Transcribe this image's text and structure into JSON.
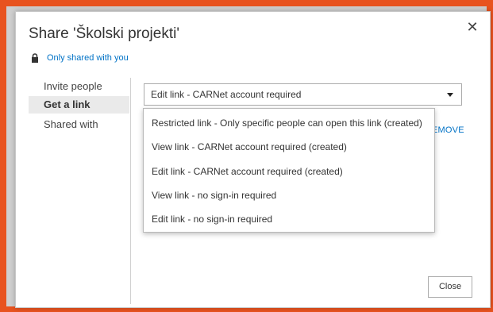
{
  "dialog": {
    "title": "Share 'Školski projekti'",
    "permission_text": "Only shared with you",
    "close_icon": "close-icon"
  },
  "nav": {
    "items": [
      {
        "label": "Invite people"
      },
      {
        "label": "Get a link"
      },
      {
        "label": "Shared with"
      }
    ],
    "active": "Get a link"
  },
  "link_select": {
    "value": "Edit link - CARNet account required",
    "options": [
      "Restricted link - Only specific people can open this link (created)",
      "View link - CARNet account required (created)",
      "Edit link - CARNet account required (created)",
      "View link - no sign-in required",
      "Edit link - no sign-in required"
    ]
  },
  "remove_label": "EMOVE",
  "footer": {
    "close_label": "Close"
  },
  "colors": {
    "accent": "#0072c6",
    "frame": "#e8531f"
  }
}
